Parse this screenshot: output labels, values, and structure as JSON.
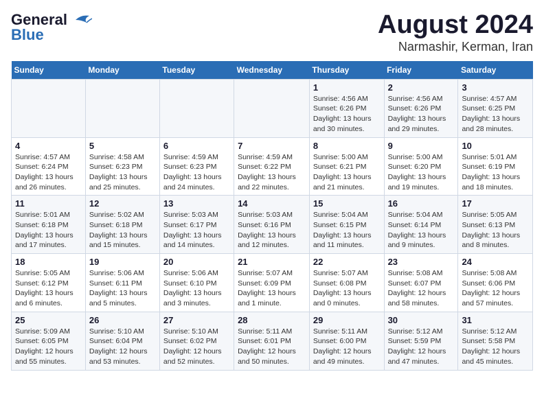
{
  "logo": {
    "line1": "General",
    "line2": "Blue"
  },
  "title": "August 2024",
  "subtitle": "Narmashir, Kerman, Iran",
  "days_header": [
    "Sunday",
    "Monday",
    "Tuesday",
    "Wednesday",
    "Thursday",
    "Friday",
    "Saturday"
  ],
  "weeks": [
    [
      {
        "num": "",
        "info": ""
      },
      {
        "num": "",
        "info": ""
      },
      {
        "num": "",
        "info": ""
      },
      {
        "num": "",
        "info": ""
      },
      {
        "num": "1",
        "info": "Sunrise: 4:56 AM\nSunset: 6:26 PM\nDaylight: 13 hours\nand 30 minutes."
      },
      {
        "num": "2",
        "info": "Sunrise: 4:56 AM\nSunset: 6:26 PM\nDaylight: 13 hours\nand 29 minutes."
      },
      {
        "num": "3",
        "info": "Sunrise: 4:57 AM\nSunset: 6:25 PM\nDaylight: 13 hours\nand 28 minutes."
      }
    ],
    [
      {
        "num": "4",
        "info": "Sunrise: 4:57 AM\nSunset: 6:24 PM\nDaylight: 13 hours\nand 26 minutes."
      },
      {
        "num": "5",
        "info": "Sunrise: 4:58 AM\nSunset: 6:23 PM\nDaylight: 13 hours\nand 25 minutes."
      },
      {
        "num": "6",
        "info": "Sunrise: 4:59 AM\nSunset: 6:23 PM\nDaylight: 13 hours\nand 24 minutes."
      },
      {
        "num": "7",
        "info": "Sunrise: 4:59 AM\nSunset: 6:22 PM\nDaylight: 13 hours\nand 22 minutes."
      },
      {
        "num": "8",
        "info": "Sunrise: 5:00 AM\nSunset: 6:21 PM\nDaylight: 13 hours\nand 21 minutes."
      },
      {
        "num": "9",
        "info": "Sunrise: 5:00 AM\nSunset: 6:20 PM\nDaylight: 13 hours\nand 19 minutes."
      },
      {
        "num": "10",
        "info": "Sunrise: 5:01 AM\nSunset: 6:19 PM\nDaylight: 13 hours\nand 18 minutes."
      }
    ],
    [
      {
        "num": "11",
        "info": "Sunrise: 5:01 AM\nSunset: 6:18 PM\nDaylight: 13 hours\nand 17 minutes."
      },
      {
        "num": "12",
        "info": "Sunrise: 5:02 AM\nSunset: 6:18 PM\nDaylight: 13 hours\nand 15 minutes."
      },
      {
        "num": "13",
        "info": "Sunrise: 5:03 AM\nSunset: 6:17 PM\nDaylight: 13 hours\nand 14 minutes."
      },
      {
        "num": "14",
        "info": "Sunrise: 5:03 AM\nSunset: 6:16 PM\nDaylight: 13 hours\nand 12 minutes."
      },
      {
        "num": "15",
        "info": "Sunrise: 5:04 AM\nSunset: 6:15 PM\nDaylight: 13 hours\nand 11 minutes."
      },
      {
        "num": "16",
        "info": "Sunrise: 5:04 AM\nSunset: 6:14 PM\nDaylight: 13 hours\nand 9 minutes."
      },
      {
        "num": "17",
        "info": "Sunrise: 5:05 AM\nSunset: 6:13 PM\nDaylight: 13 hours\nand 8 minutes."
      }
    ],
    [
      {
        "num": "18",
        "info": "Sunrise: 5:05 AM\nSunset: 6:12 PM\nDaylight: 13 hours\nand 6 minutes."
      },
      {
        "num": "19",
        "info": "Sunrise: 5:06 AM\nSunset: 6:11 PM\nDaylight: 13 hours\nand 5 minutes."
      },
      {
        "num": "20",
        "info": "Sunrise: 5:06 AM\nSunset: 6:10 PM\nDaylight: 13 hours\nand 3 minutes."
      },
      {
        "num": "21",
        "info": "Sunrise: 5:07 AM\nSunset: 6:09 PM\nDaylight: 13 hours\nand 1 minute."
      },
      {
        "num": "22",
        "info": "Sunrise: 5:07 AM\nSunset: 6:08 PM\nDaylight: 13 hours\nand 0 minutes."
      },
      {
        "num": "23",
        "info": "Sunrise: 5:08 AM\nSunset: 6:07 PM\nDaylight: 12 hours\nand 58 minutes."
      },
      {
        "num": "24",
        "info": "Sunrise: 5:08 AM\nSunset: 6:06 PM\nDaylight: 12 hours\nand 57 minutes."
      }
    ],
    [
      {
        "num": "25",
        "info": "Sunrise: 5:09 AM\nSunset: 6:05 PM\nDaylight: 12 hours\nand 55 minutes."
      },
      {
        "num": "26",
        "info": "Sunrise: 5:10 AM\nSunset: 6:04 PM\nDaylight: 12 hours\nand 53 minutes."
      },
      {
        "num": "27",
        "info": "Sunrise: 5:10 AM\nSunset: 6:02 PM\nDaylight: 12 hours\nand 52 minutes."
      },
      {
        "num": "28",
        "info": "Sunrise: 5:11 AM\nSunset: 6:01 PM\nDaylight: 12 hours\nand 50 minutes."
      },
      {
        "num": "29",
        "info": "Sunrise: 5:11 AM\nSunset: 6:00 PM\nDaylight: 12 hours\nand 49 minutes."
      },
      {
        "num": "30",
        "info": "Sunrise: 5:12 AM\nSunset: 5:59 PM\nDaylight: 12 hours\nand 47 minutes."
      },
      {
        "num": "31",
        "info": "Sunrise: 5:12 AM\nSunset: 5:58 PM\nDaylight: 12 hours\nand 45 minutes."
      }
    ]
  ]
}
